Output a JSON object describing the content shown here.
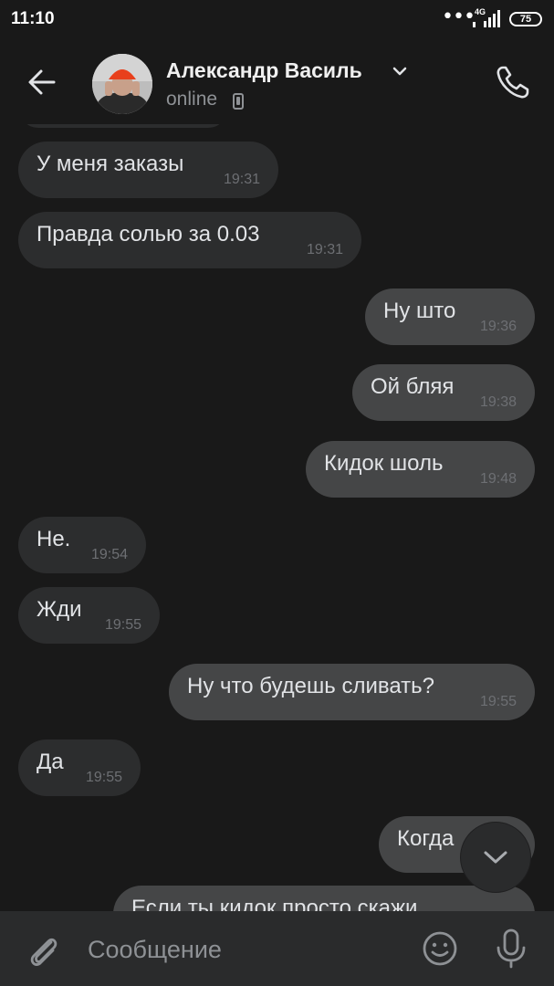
{
  "status_bar": {
    "time": "11:10",
    "network": "4G",
    "battery": "75"
  },
  "header": {
    "contact_name": "Александр Василь",
    "contact_status": "online"
  },
  "messages": [
    {
      "direction": "in",
      "text": "У меня заказы",
      "time": "19:31"
    },
    {
      "direction": "in",
      "text": "Правда солью за 0.03",
      "time": "19:31"
    },
    {
      "direction": "out",
      "text": "Ну што",
      "time": "19:36"
    },
    {
      "direction": "out",
      "text": "Ой бляя",
      "time": "19:38"
    },
    {
      "direction": "out",
      "text": "Кидок шоль",
      "time": "19:48"
    },
    {
      "direction": "in",
      "text": "Не.",
      "time": "19:54"
    },
    {
      "direction": "in",
      "text": "Жди",
      "time": "19:55"
    },
    {
      "direction": "out",
      "text": "Ну что будешь сливать?",
      "time": "19:55"
    },
    {
      "direction": "in",
      "text": "Да",
      "time": "19:55"
    },
    {
      "direction": "out",
      "text": "Когда",
      "time": ""
    },
    {
      "direction": "out",
      "text": "Если ты кидок просто скажи",
      "time": ""
    }
  ],
  "composer": {
    "placeholder": "Сообщение"
  },
  "colors": {
    "background": "#191919",
    "incoming_bubble": "#2c2d2e",
    "outgoing_bubble": "#454647",
    "composer": "#2a2b2c",
    "timestamp": "#6d6f73"
  },
  "icons": {
    "back": "arrow-left-icon",
    "call": "phone-icon",
    "attach": "paperclip-icon",
    "emoji": "smiley-icon",
    "mic": "microphone-icon",
    "scroll": "chevron-down-icon"
  }
}
